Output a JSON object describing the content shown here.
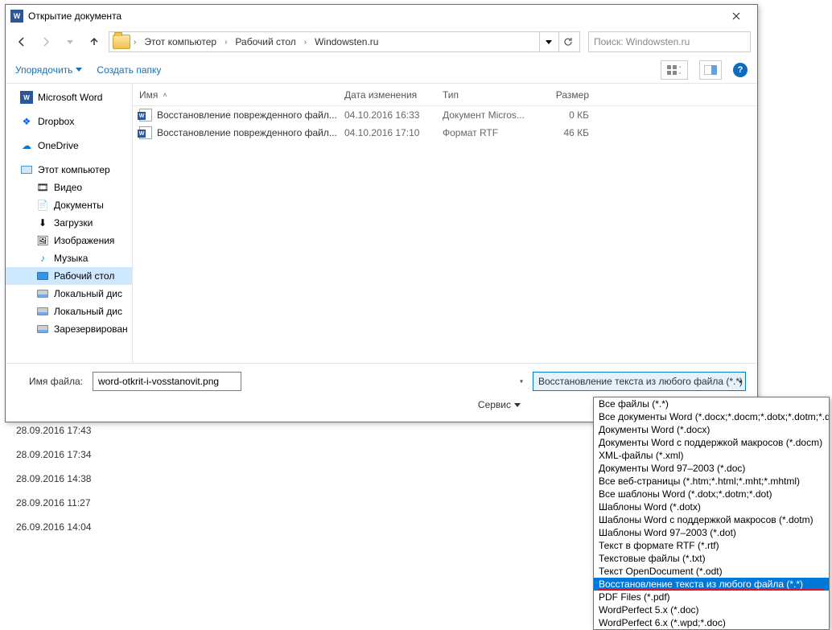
{
  "dialog": {
    "title": "Открытие документа",
    "breadcrumb": [
      "Этот компьютер",
      "Рабочий стол",
      "Windowsten.ru"
    ],
    "search_placeholder": "Поиск: Windowsten.ru"
  },
  "toolbar": {
    "organize": "Упорядочить",
    "new_folder": "Создать папку"
  },
  "sidebar": {
    "word": "Microsoft Word",
    "dropbox": "Dropbox",
    "onedrive": "OneDrive",
    "this_pc": "Этот компьютер",
    "videos": "Видео",
    "documents": "Документы",
    "downloads": "Загрузки",
    "pictures": "Изображения",
    "music": "Музыка",
    "desktop": "Рабочий стол",
    "disk_c": "Локальный дис",
    "disk_d": "Локальный дис",
    "reserved": "Зарезервирован"
  },
  "columns": {
    "name": "Имя",
    "date": "Дата изменения",
    "type": "Тип",
    "size": "Размер"
  },
  "files": [
    {
      "name": "Восстановление поврежденного файл...",
      "date": "04.10.2016 16:33",
      "type": "Документ Micros...",
      "size": "0 КБ"
    },
    {
      "name": "Восстановление поврежденного файл...",
      "date": "04.10.2016 17:10",
      "type": "Формат RTF",
      "size": "46 КБ"
    }
  ],
  "footer": {
    "filename_label": "Имя файла:",
    "filename_value": "word-otkrit-i-vosstanovit.png",
    "filter_selected": "Восстановление текста из любого файла (*.*)",
    "tools": "Сервис"
  },
  "dropdown": [
    "Все файлы (*.*)",
    "Все документы Word (*.docx;*.docm;*.dotx;*.dotm;*.doc;*.dot)",
    "Документы Word (*.docx)",
    "Документы Word с поддержкой макросов (*.docm)",
    "XML-файлы (*.xml)",
    "Документы Word 97–2003 (*.doc)",
    "Все веб-страницы (*.htm;*.html;*.mht;*.mhtml)",
    "Все шаблоны Word (*.dotx;*.dotm;*.dot)",
    "Шаблоны Word (*.dotx)",
    "Шаблоны Word с поддержкой макросов (*.dotm)",
    "Шаблоны Word 97–2003 (*.dot)",
    "Текст в формате RTF (*.rtf)",
    "Текстовые файлы (*.txt)",
    "Текст OpenDocument (*.odt)",
    "Восстановление текста из любого файла (*.*)",
    "PDF Files (*.pdf)",
    "WordPerfect 5.x (*.doc)",
    "WordPerfect 6.x (*.wpd;*.doc)"
  ],
  "dropdown_selected_index": 14,
  "background_times": [
    "28.09.2016 17:43",
    "28.09.2016 17:34",
    "28.09.2016 14:38",
    "28.09.2016 11:27",
    "26.09.2016 14:04"
  ]
}
